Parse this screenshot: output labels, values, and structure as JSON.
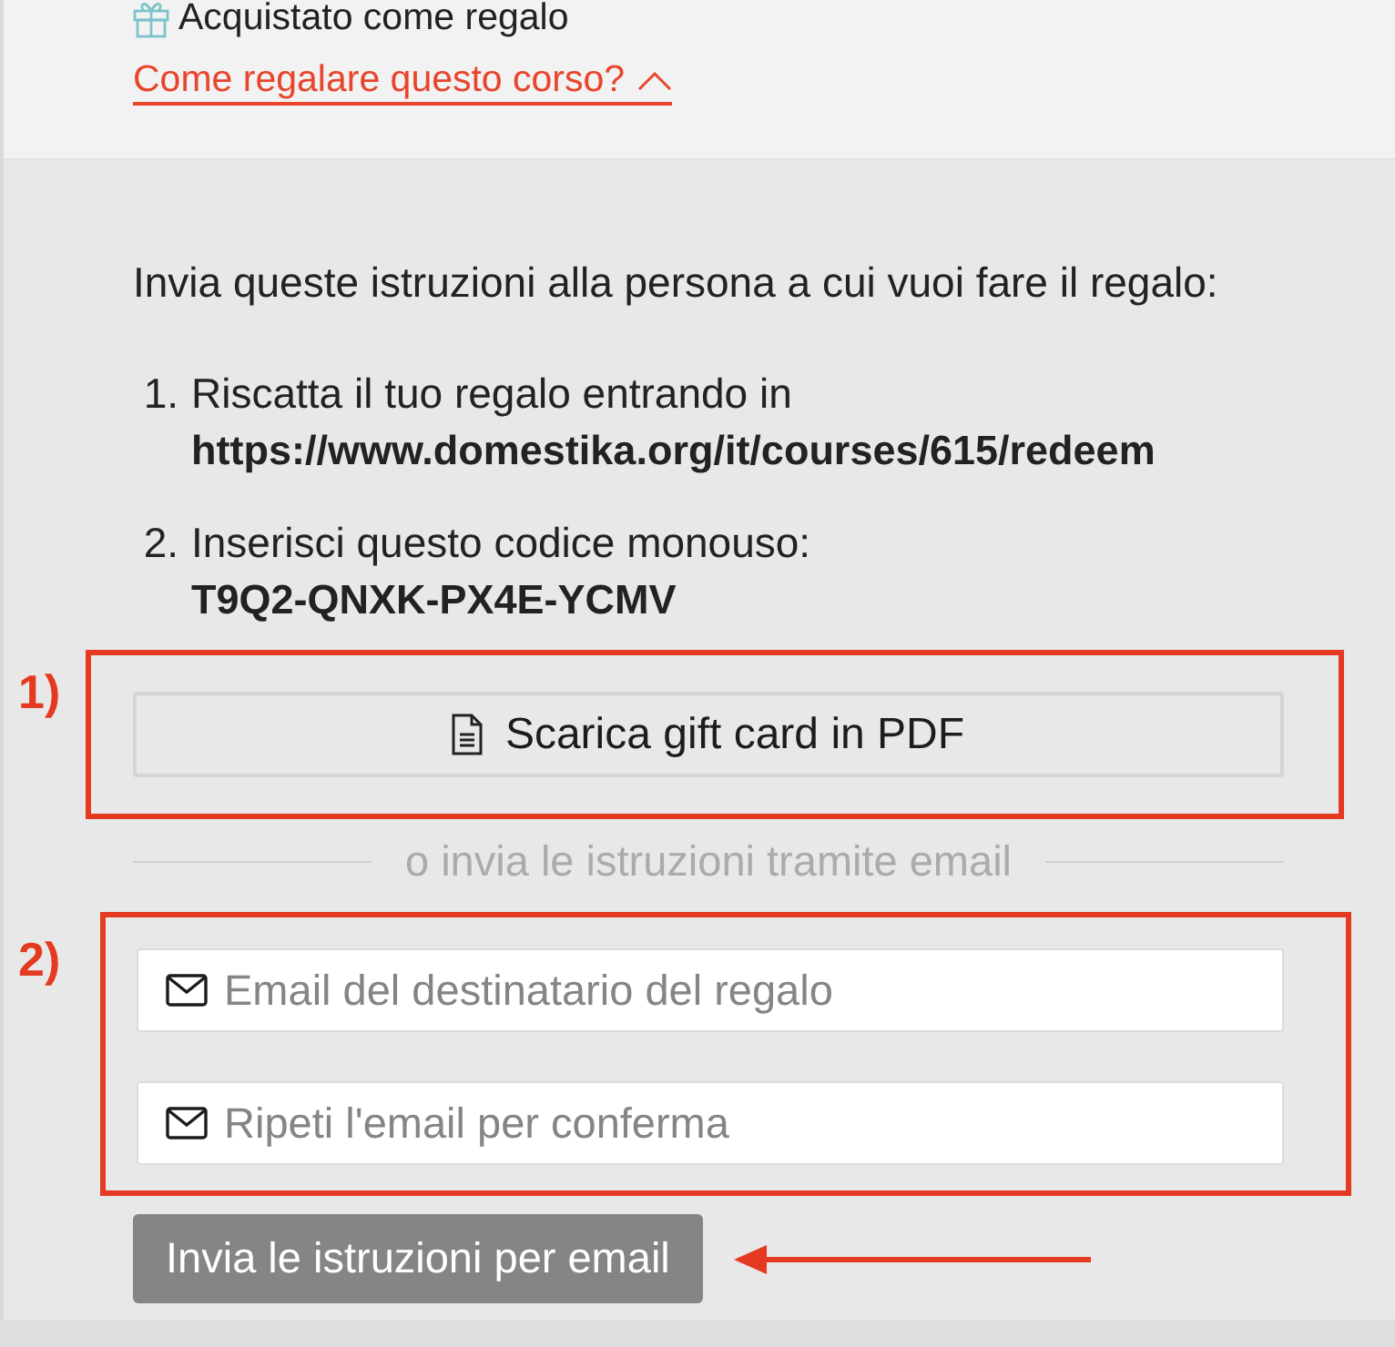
{
  "top": {
    "status": "Acquistato come regalo",
    "link": {
      "text": "Come regalare questo corso?",
      "expanded": true
    }
  },
  "panel": {
    "intro": "Invia queste istruzioni alla persona a cui vuoi fare il regalo:",
    "steps": [
      {
        "number": "1.",
        "text": "Riscatta il tuo regalo entrando in",
        "value": "https://www.domestika.org/it/courses/615/redeem"
      },
      {
        "number": "2.",
        "text": "Inserisci questo codice monouso:",
        "value": "T9Q2-QNXK-PX4E-YCMV"
      }
    ],
    "download_button": "Scarica gift card in PDF",
    "divider": "o invia le istruzioni tramite email",
    "fields": [
      {
        "placeholder": "Email del destinatario del regalo"
      },
      {
        "placeholder": "Ripeti l'email per conferma"
      }
    ],
    "submit_button": {
      "label": "Invia le istruzioni per email",
      "disabled": true
    }
  },
  "annotations": [
    {
      "label": "1)"
    },
    {
      "label": "2)"
    }
  ]
}
